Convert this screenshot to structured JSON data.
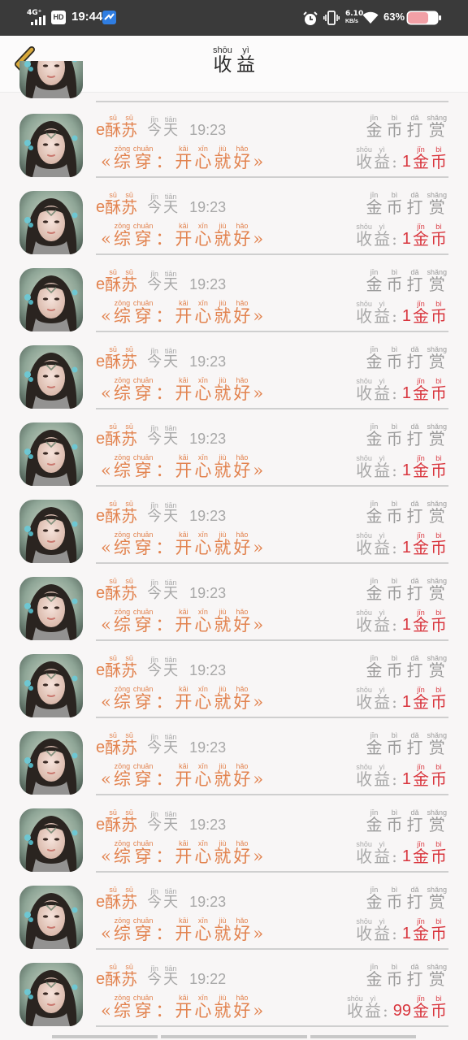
{
  "status_bar": {
    "network": "4G⁺",
    "hd": "HD",
    "time": "19:44",
    "speed_value": "6.10",
    "speed_unit": "KB/s",
    "battery": "63%"
  },
  "header": {
    "title": [
      {
        "hanzi": "收",
        "pinyin": "shōu"
      },
      {
        "hanzi": "益",
        "pinyin": "yì"
      }
    ]
  },
  "common": {
    "name_prefix": "e",
    "name": [
      {
        "hanzi": "酥",
        "pinyin": "sū"
      },
      {
        "hanzi": "苏",
        "pinyin": "sū"
      }
    ],
    "today": [
      {
        "hanzi": "今",
        "pinyin": "jīn"
      },
      {
        "hanzi": "天",
        "pinyin": "tiān"
      }
    ],
    "reward": [
      {
        "hanzi": "金",
        "pinyin": "jīn"
      },
      {
        "hanzi": "币",
        "pinyin": "bì"
      },
      {
        "hanzi": "打",
        "pinyin": "dǎ"
      },
      {
        "hanzi": "赏",
        "pinyin": "shǎng"
      }
    ],
    "book_open": "«",
    "book_close": "»",
    "book_part1": [
      {
        "hanzi": "综",
        "pinyin": "zōng"
      },
      {
        "hanzi": "穿",
        "pinyin": "chuān"
      }
    ],
    "book_colon": "：",
    "book_part2": [
      {
        "hanzi": "开",
        "pinyin": "kāi"
      },
      {
        "hanzi": "心",
        "pinyin": "xīn"
      },
      {
        "hanzi": "就",
        "pinyin": "jiù"
      },
      {
        "hanzi": "好",
        "pinyin": "hǎo"
      }
    ],
    "earn_label": [
      {
        "hanzi": "收",
        "pinyin": "shōu"
      },
      {
        "hanzi": "益",
        "pinyin": "yì"
      }
    ],
    "earn_colon": ":",
    "coin": [
      {
        "hanzi": "金",
        "pinyin": "jīn"
      },
      {
        "hanzi": "币",
        "pinyin": "bì"
      }
    ]
  },
  "rows": [
    {
      "time": "19:23",
      "amount": "1"
    },
    {
      "time": "19:23",
      "amount": "1"
    },
    {
      "time": "19:23",
      "amount": "1"
    },
    {
      "time": "19:23",
      "amount": "1"
    },
    {
      "time": "19:23",
      "amount": "1"
    },
    {
      "time": "19:23",
      "amount": "1"
    },
    {
      "time": "19:23",
      "amount": "1"
    },
    {
      "time": "19:23",
      "amount": "1"
    },
    {
      "time": "19:23",
      "amount": "1"
    },
    {
      "time": "19:23",
      "amount": "1"
    },
    {
      "time": "19:23",
      "amount": "1"
    },
    {
      "time": "19:22",
      "amount": "99"
    }
  ],
  "colors": {
    "orange": "#e2834f",
    "gray": "#a8a8a8",
    "red": "#d9363e",
    "back_arrow": "#d9a93b",
    "status_bar": "#3a3a3a"
  },
  "icons": {
    "back": "back-arrow-icon",
    "app": "app-notification-icon",
    "alarm": "alarm-icon",
    "vibrate": "vibrate-icon",
    "wifi": "wifi-icon",
    "battery": "battery-icon",
    "avatar": "user-avatar"
  }
}
